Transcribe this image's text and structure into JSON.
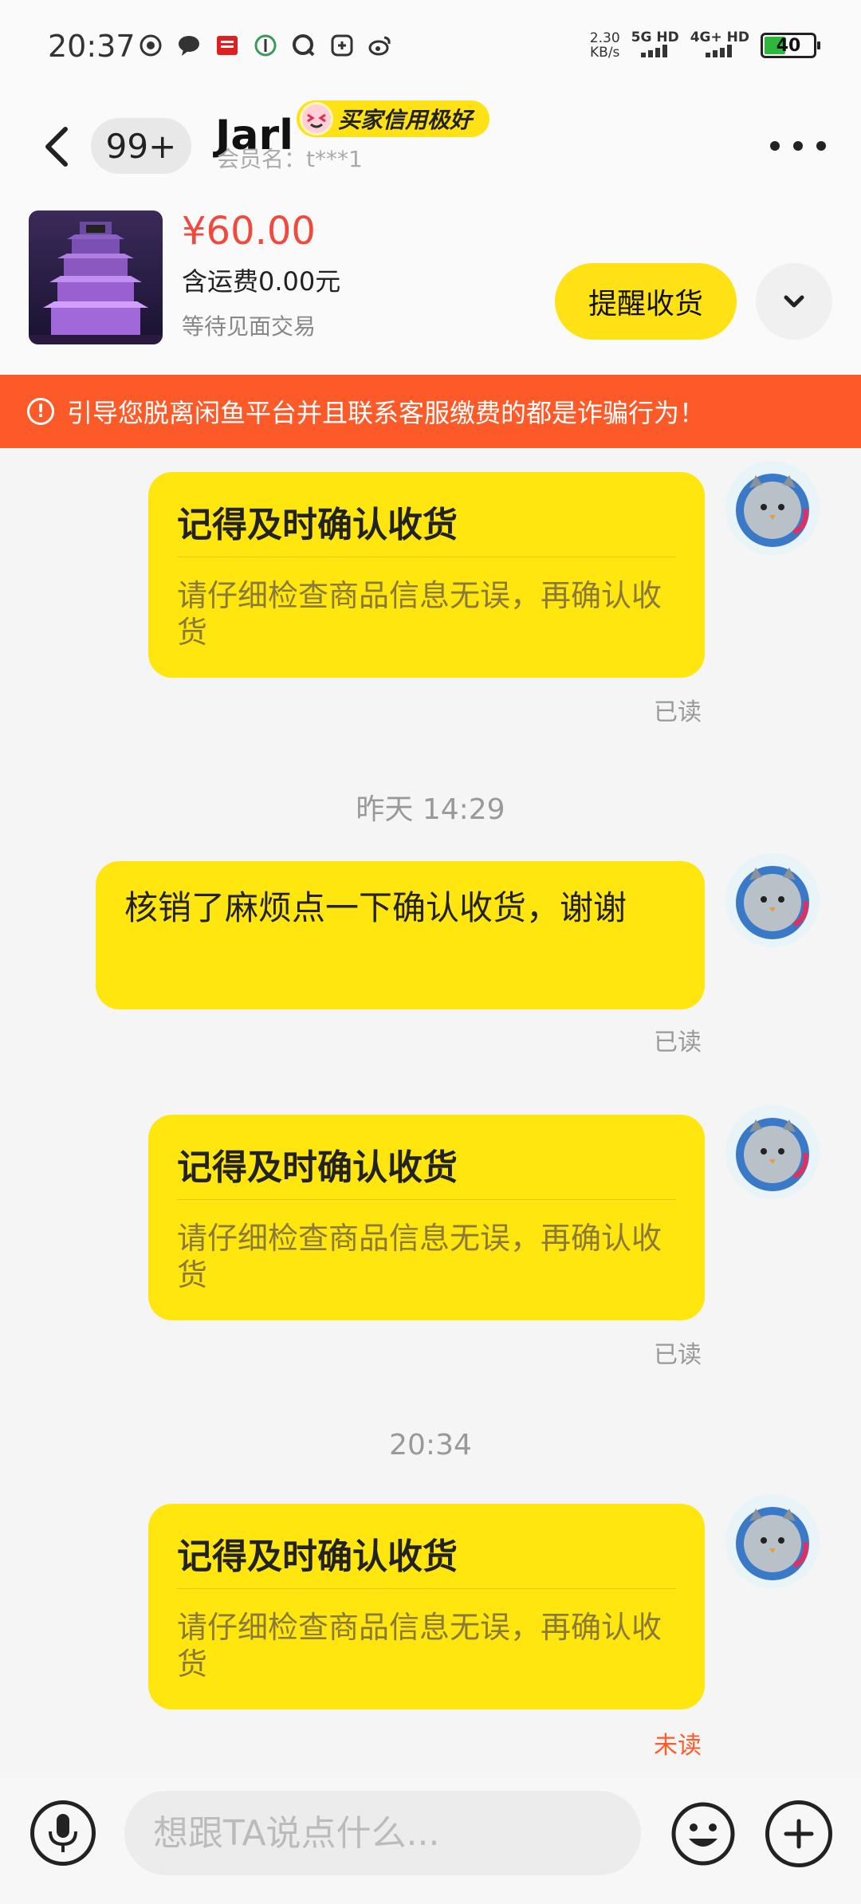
{
  "status_bar": {
    "time": "20:37",
    "speed": "2.30",
    "speed_unit": "KB/s",
    "net1": "5G HD",
    "net2": "4G+ HD",
    "battery": "40"
  },
  "header": {
    "unread_count": "99+",
    "name": "Jarl",
    "credit_label": "买家信用极好",
    "member": "会员名：t***1"
  },
  "product": {
    "price": "¥60.00",
    "shipping": "含运费0.00元",
    "status": "等待见面交易",
    "remind_button": "提醒收货"
  },
  "warning": "引导您脱离闲鱼平台并且联系客服缴费的都是诈骗行为！",
  "messages": [
    {
      "title": "记得及时确认收货",
      "body": "请仔细检查商品信息无误，再确认收货",
      "read": "已读"
    },
    {
      "timestamp": "昨天 14:29"
    },
    {
      "text": "核销了麻烦点一下确认收货，谢谢",
      "read": "已读"
    },
    {
      "title": "记得及时确认收货",
      "body": "请仔细检查商品信息无误，再确认收货",
      "read": "已读"
    },
    {
      "timestamp": "20:34"
    },
    {
      "title": "记得及时确认收货",
      "body": "请仔细检查商品信息无误，再确认收货",
      "read": "未读"
    }
  ],
  "input": {
    "placeholder": "想跟TA说点什么..."
  },
  "colors": {
    "accent_yellow": "#ffe60f",
    "warning_orange": "#fd5a2a",
    "price_red": "#f04a3e",
    "unread_red": "#ff5a2a"
  },
  "icons": {
    "status": [
      "signal-icon",
      "message-icon",
      "news-app-icon",
      "hotspot-icon",
      "qq-icon",
      "app-icon",
      "weibo-icon"
    ],
    "header": [
      "back-icon",
      "more-icon"
    ],
    "input": [
      "microphone-icon",
      "emoji-icon",
      "plus-icon"
    ]
  }
}
